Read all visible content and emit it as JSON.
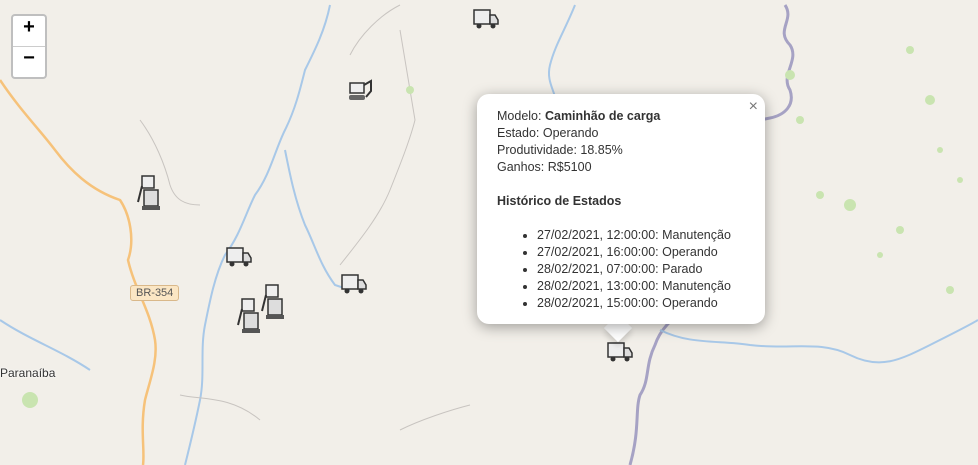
{
  "zoom": {
    "in_label": "+",
    "out_label": "−"
  },
  "map_labels": {
    "road": "BR-354",
    "city": "Paranaíba"
  },
  "colors": {
    "water": "#a0c8f0",
    "road": "#f6c27a",
    "border": "#9e9cab",
    "land": "#f2efe9"
  },
  "markers": [
    {
      "type": "truck-icon"
    },
    {
      "type": "excavator-icon"
    },
    {
      "type": "excavator-icon"
    },
    {
      "type": "truck-icon"
    },
    {
      "type": "truck-icon"
    },
    {
      "type": "excavator-icon"
    },
    {
      "type": "excavator-icon"
    },
    {
      "type": "truck-icon"
    }
  ],
  "popup": {
    "close_label": "×",
    "modelo_label": "Modelo:",
    "modelo_value": "Caminhão de carga",
    "estado_label": "Estado:",
    "estado_value": "Operando",
    "produtividade_label": "Produtividade:",
    "produtividade_value": "18.85%",
    "ganhos_label": "Ganhos:",
    "ganhos_value": "R$5100",
    "historico_title": "Histórico de Estados",
    "historico": [
      "27/02/2021, 12:00:00: Manutenção",
      "27/02/2021, 16:00:00: Operando",
      "28/02/2021, 07:00:00: Parado",
      "28/02/2021, 13:00:00: Manutenção",
      "28/02/2021, 15:00:00: Operando"
    ]
  }
}
